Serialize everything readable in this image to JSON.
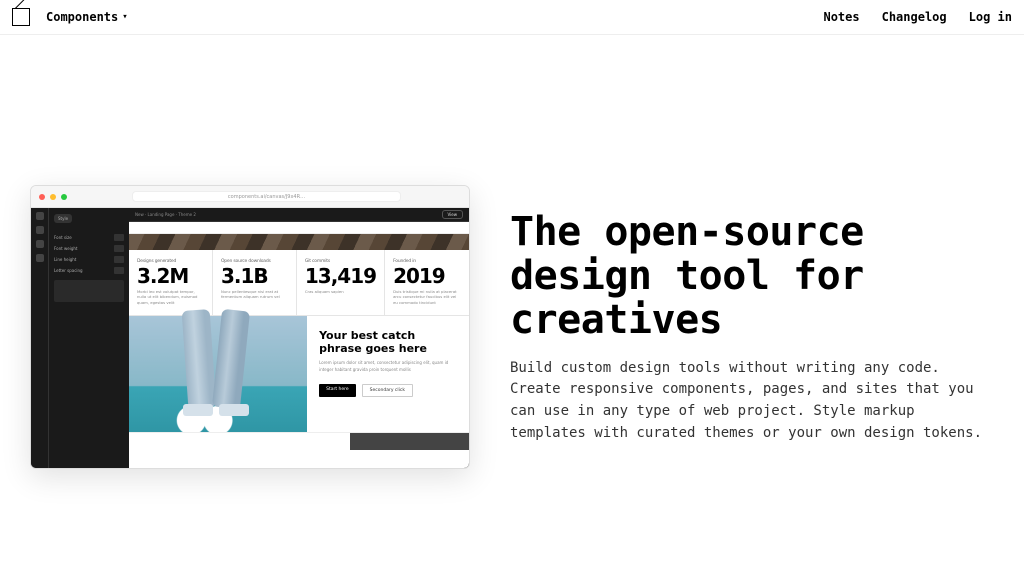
{
  "nav": {
    "primary": "Components",
    "links": [
      "Notes",
      "Changelog",
      "Log in"
    ]
  },
  "hero": {
    "heading": "The open-source design tool for creatives",
    "body": "Build custom design tools without writing any code. Create responsive components, pages, and sites that you can use in any type of web project. Style markup templates with curated themes or your own design tokens."
  },
  "mock": {
    "address": "components.ai/canvas/J9x4R…",
    "topbar_left": "New · Landing Page · Theme 2",
    "topbar_view": "View",
    "sidebar_chip": "Style",
    "sidebar_fields": [
      "Font size",
      "Font weight",
      "Line height",
      "Letter spacing"
    ],
    "stats": [
      {
        "label": "Designs generated",
        "value": "3.2M",
        "desc": "Morbi leo est volutpat tempor, nulla ut elit bibendum, euismod quam, egestas velit"
      },
      {
        "label": "Open source downloads",
        "value": "3.1B",
        "desc": "Nunc pellentesque nisl erat at fermentum aliquam rutrum vel"
      },
      {
        "label": "Git commits",
        "value": "13,419",
        "desc": "Cras aliquam sapien"
      },
      {
        "label": "Founded in",
        "value": "2019",
        "desc": "Duis tristique mi nulla at placerat arcu consectetur faucibus elit vel eu commodo tincidunt"
      }
    ],
    "catch": {
      "title": "Your best catch phrase goes here",
      "body": "Lorem ipsum dolor sit amet, consectetur adipiscing elit, quam id integer habitant gravida proin torquent mollis",
      "primary": "Start here",
      "secondary": "Secondary click"
    }
  }
}
